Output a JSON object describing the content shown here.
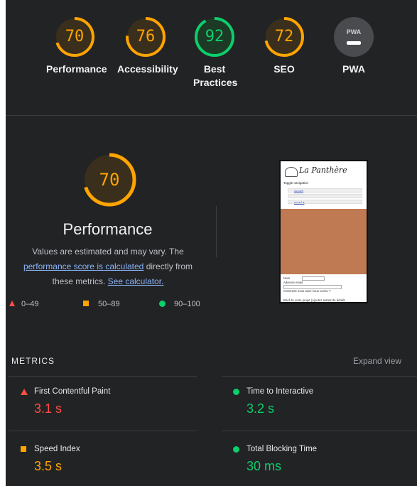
{
  "colors": {
    "fail": "#ff4e42",
    "average": "#ffa400",
    "pass": "#0cce6b",
    "background": "#222325"
  },
  "categories": [
    {
      "score": "70",
      "label": "Performance",
      "rating": "average"
    },
    {
      "score": "76",
      "label": "Accessibility",
      "rating": "average"
    },
    {
      "score": "92",
      "label": "Best Practices",
      "rating": "pass"
    },
    {
      "score": "72",
      "label": "SEO",
      "rating": "average"
    },
    {
      "score": "",
      "label": "PWA",
      "badge": "PWA",
      "rating": "na"
    }
  ],
  "performance": {
    "score": "70",
    "title": "Performance",
    "note_prefix": "Values are estimated and may vary. The",
    "note_link": "performance score is calculated",
    "note_middle": "directly from these metrics.",
    "note_link2": "See calculator."
  },
  "legend": {
    "fail": "0–49",
    "average": "50–89",
    "pass": "90–100"
  },
  "thumbnail": {
    "site_title": "La Panthère",
    "toggle": "Toggle navigation",
    "nav": [
      "Accueil",
      "",
      "more2 ▾"
    ],
    "form": {
      "name": "Nom",
      "email": "Adresse email",
      "how": "Comment nous avez-vous connu ?",
      "brief": "Brief de votre projet (Ajoutez autant de détails"
    }
  },
  "metrics": {
    "heading": "METRICS",
    "expand": "Expand view",
    "items": [
      {
        "label": "First Contentful Paint",
        "value": "3.1 s",
        "rating": "fail"
      },
      {
        "label": "Time to Interactive",
        "value": "3.2 s",
        "rating": "pass"
      },
      {
        "label": "Speed Index",
        "value": "3.5 s",
        "rating": "average"
      },
      {
        "label": "Total Blocking Time",
        "value": "30 ms",
        "rating": "pass"
      }
    ]
  }
}
